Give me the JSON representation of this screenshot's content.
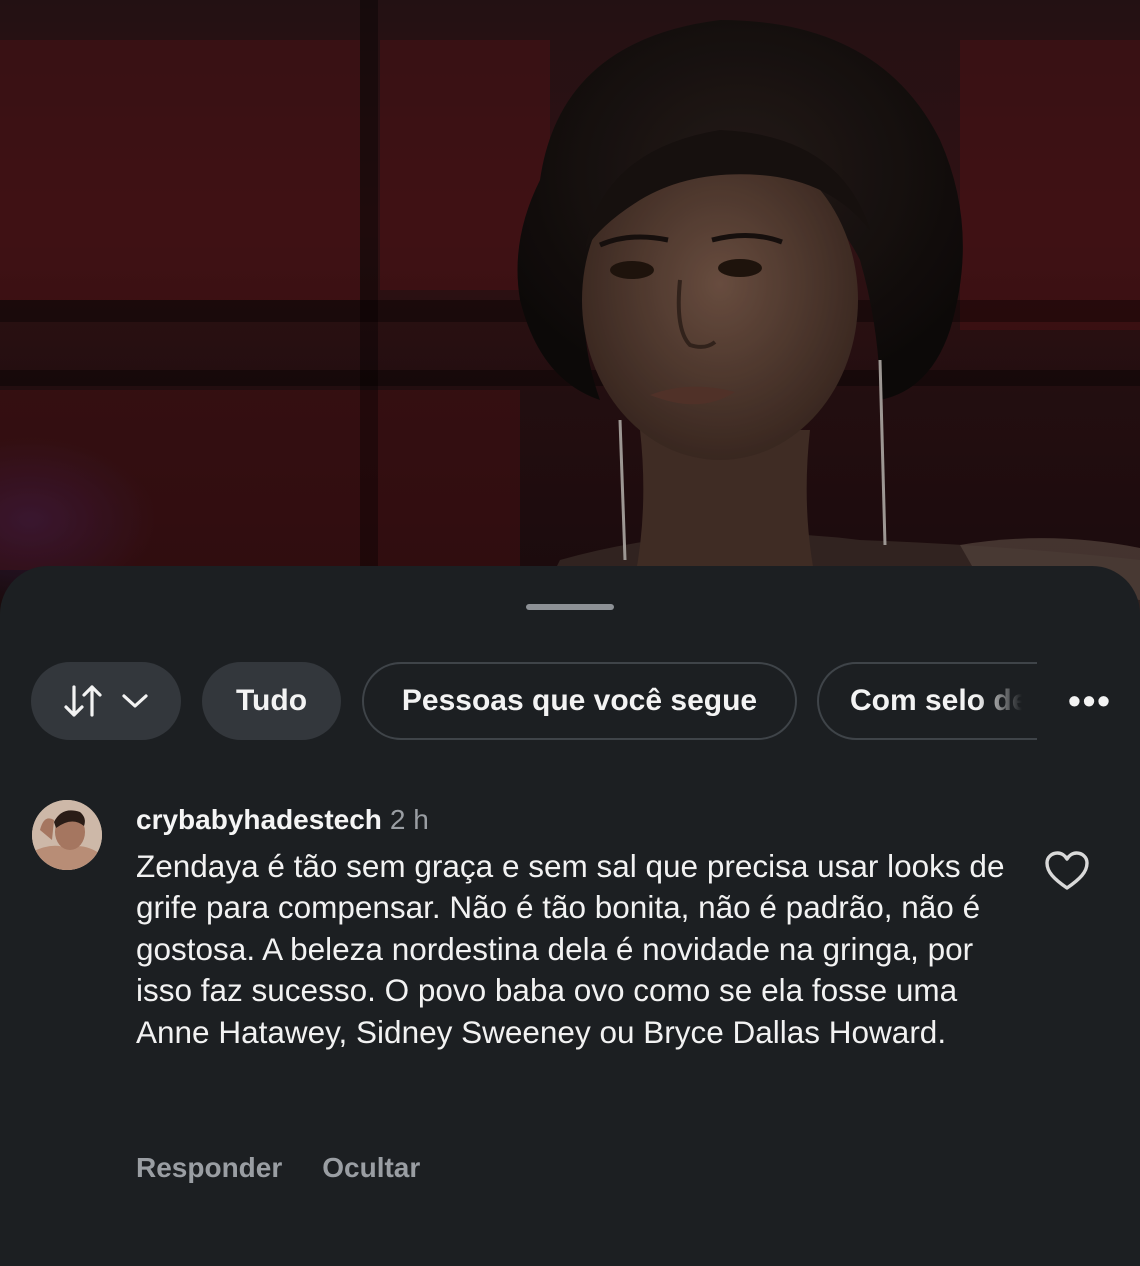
{
  "filters": {
    "sort_icon": "sort-arrows-icon",
    "sort_chevron": "chevron-down-icon",
    "all": "Tudo",
    "following": "Pessoas que você segue",
    "verified": "Com selo de verificação",
    "more": "•••"
  },
  "comment": {
    "username": "crybabyhadestech",
    "time": "2 h",
    "text": "Zendaya é tão sem graça e sem sal que precisa usar looks de grife para compensar. Não é tão bonita, não é padrão, não é gostosa. A beleza nordestina dela é novidade na gringa, por isso faz sucesso. O povo baba ovo como se ela fosse uma Anne Hatawey, Sidney Sweeney ou Bryce Dallas Howard.",
    "like_icon": "heart-outline-icon",
    "reply": "Responder",
    "hide": "Ocultar"
  },
  "colors": {
    "sheet_bg": "#1c1f22",
    "chip_bg": "#33373c",
    "muted_text": "#9a9ea3"
  }
}
